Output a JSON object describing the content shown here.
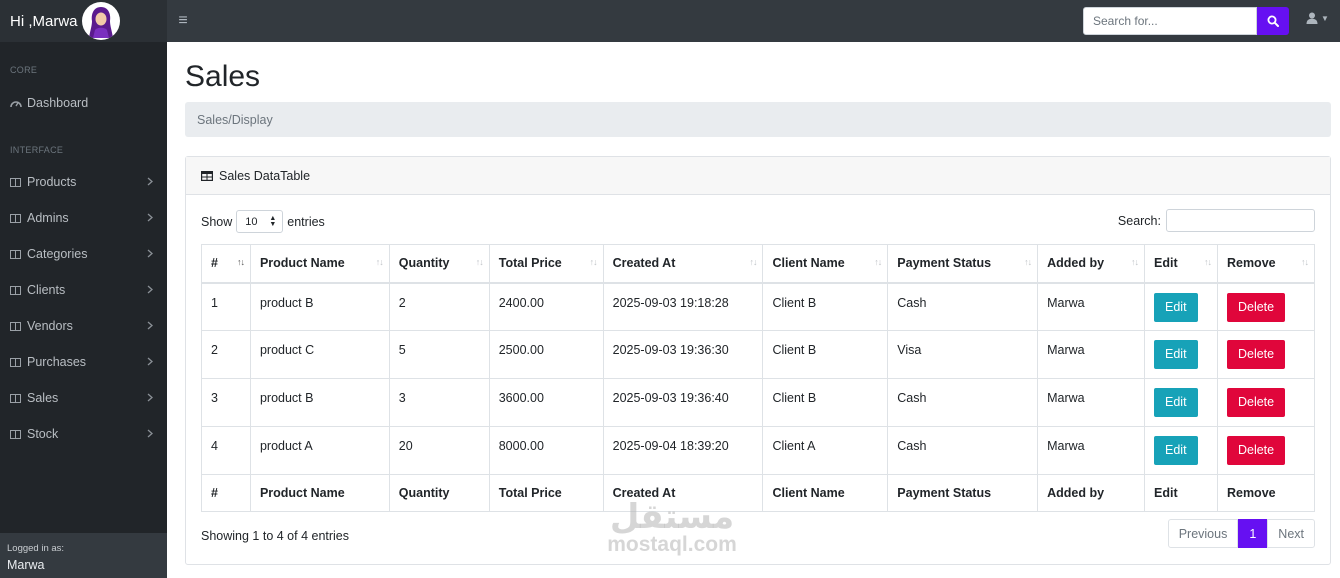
{
  "topbar": {
    "greeting": "Hi ,Marwa",
    "search_placeholder": "Search for..."
  },
  "sidebar": {
    "heading_core": "CORE",
    "dashboard": "Dashboard",
    "heading_interface": "INTERFACE",
    "items": [
      {
        "label": "Products"
      },
      {
        "label": "Admins"
      },
      {
        "label": "Categories"
      },
      {
        "label": "Clients"
      },
      {
        "label": "Vendors"
      },
      {
        "label": "Purchases"
      },
      {
        "label": "Sales"
      },
      {
        "label": "Stock"
      }
    ],
    "footer_label": "Logged in as:",
    "footer_user": "Marwa"
  },
  "page": {
    "title": "Sales",
    "breadcrumb": "Sales/Display"
  },
  "card": {
    "header": "Sales DataTable",
    "show_label": "Show",
    "length_value": "10",
    "entries_label": "entries",
    "search_label": "Search:",
    "info": "Showing 1 to 4 of 4 entries",
    "pager": {
      "previous": "Previous",
      "current": "1",
      "next": "Next"
    }
  },
  "table": {
    "columns": [
      "#",
      "Product Name",
      "Quantity",
      "Total Price",
      "Created At",
      "Client Name",
      "Payment Status",
      "Added by",
      "Edit",
      "Remove"
    ],
    "rows": [
      {
        "id": "1",
        "product": "product B",
        "qty": "2",
        "total": "2400.00",
        "created": "2025-09-03 19:18:28",
        "client": "Client B",
        "payment": "Cash",
        "added_by": "Marwa"
      },
      {
        "id": "2",
        "product": "product C",
        "qty": "5",
        "total": "2500.00",
        "created": "2025-09-03 19:36:30",
        "client": "Client B",
        "payment": "Visa",
        "added_by": "Marwa"
      },
      {
        "id": "3",
        "product": "product B",
        "qty": "3",
        "total": "3600.00",
        "created": "2025-09-03 19:36:40",
        "client": "Client B",
        "payment": "Cash",
        "added_by": "Marwa"
      },
      {
        "id": "4",
        "product": "product A",
        "qty": "20",
        "total": "8000.00",
        "created": "2025-09-04 18:39:20",
        "client": "Client A",
        "payment": "Cash",
        "added_by": "Marwa"
      }
    ],
    "edit_label": "Edit",
    "delete_label": "Delete"
  },
  "watermark": {
    "arabic": "مستقل",
    "latin": "mostaql.com"
  },
  "colors": {
    "accent": "#6610f2",
    "edit": "#17a2b8",
    "delete": "#e0063b",
    "sidebar": "#212529",
    "topbar": "#343a40"
  }
}
